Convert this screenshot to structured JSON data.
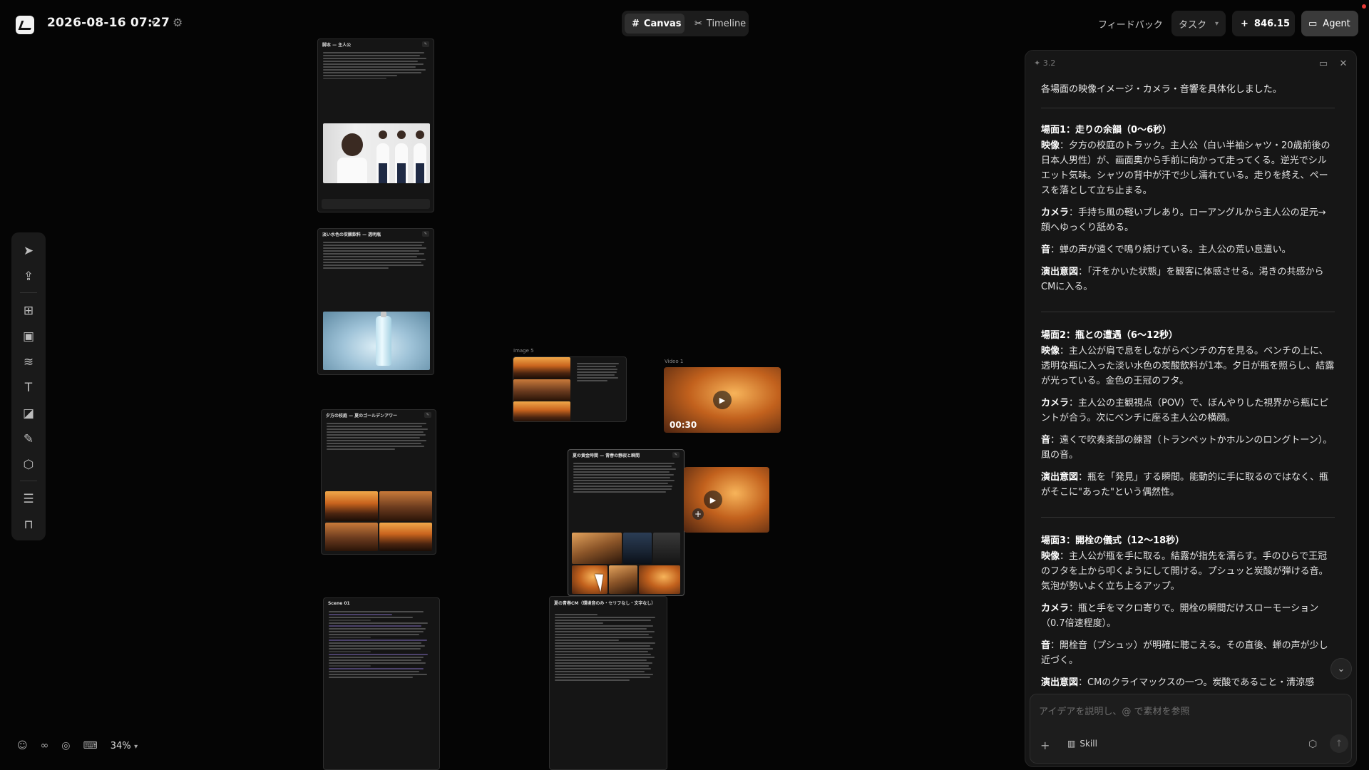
{
  "topbar": {
    "project_title": "2026-08-16 07:27",
    "tabs": [
      {
        "label": "Canvas",
        "icon": "grid-icon"
      },
      {
        "label": "Timeline",
        "icon": "scissors-icon"
      }
    ],
    "feedback_label": "フィードバック",
    "task_label": "タスク",
    "credits": "846.15",
    "agent_label": "Agent"
  },
  "bottom": {
    "zoom": "34%"
  },
  "canvas": {
    "image_label": "Image 5",
    "video_label": "Video 1",
    "video_duration": "00:30",
    "nodes": [
      {
        "title": "脚本 — 主人公"
      },
      {
        "title": "淡い水色の炭酸飲料 — 透明瓶"
      },
      {
        "title": "夕方の校庭 — 夏のゴールデンアワー"
      },
      {
        "title": "夏の黄金時間 — 青春の静寂と瞬間"
      },
      {
        "title": "夏の青春CM（環境音のみ・セリフなし・文字なし）"
      },
      {
        "title": "Scene 01"
      }
    ]
  },
  "panel": {
    "version": "3.2",
    "intro": "各場面の映像イメージ・カメラ・音響を具体化しました。",
    "scenes": [
      {
        "title": "場面1：走りの余韻（0〜6秒）",
        "items": [
          {
            "label": "映像",
            "text": "：夕方の校庭のトラック。主人公（白い半袖シャツ・20歳前後の日本人男性）が、画面奥から手前に向かって走ってくる。逆光でシルエット気味。シャツの背中が汗で少し濡れている。走りを終え、ペースを落として立ち止まる。"
          },
          {
            "label": "カメラ",
            "text": "：手持ち風の軽いブレあり。ローアングルから主人公の足元→顔へゆっくり舐める。"
          },
          {
            "label": "音",
            "text": "：蝉の声が遠くで鳴り続けている。主人公の荒い息遣い。"
          },
          {
            "label": "演出意図",
            "text": "：「汗をかいた状態」を観客に体感させる。渇きの共感からCMに入る。"
          }
        ]
      },
      {
        "title": "場面2：瓶との遭遇（6〜12秒）",
        "items": [
          {
            "label": "映像",
            "text": "：主人公が肩で息をしながらベンチの方を見る。ベンチの上に、透明な瓶に入った淡い水色の炭酸飲料が1本。夕日が瓶を照らし、結露が光っている。金色の王冠のフタ。"
          },
          {
            "label": "カメラ",
            "text": "：主人公の主観視点（POV）で、ぼんやりした視界から瓶にピントが合う。次にベンチに座る主人公の横顔。"
          },
          {
            "label": "音",
            "text": "：遠くで吹奏楽部の練習（トランペットかホルンのロングトーン）。風の音。"
          },
          {
            "label": "演出意図",
            "text": "：瓶を「発見」する瞬間。能動的に手に取るのではなく、瓶がそこに\"あった\"という偶然性。"
          }
        ]
      },
      {
        "title": "場面3：開栓の儀式（12〜18秒）",
        "items": [
          {
            "label": "映像",
            "text": "：主人公が瓶を手に取る。結露が指先を濡らす。手のひらで王冠のフタを上から叩くようにして開ける。プシュッと炭酸が弾ける音。気泡が勢いよく立ち上るアップ。"
          },
          {
            "label": "カメラ",
            "text": "：瓶と手をマクロ寄りで。開栓の瞬間だけスローモーション（0.7倍速程度）。"
          },
          {
            "label": "音",
            "text": "：開栓音（プシュッ）が明確に聴こえる。その直後、蝉の声が少し近づく。"
          },
          {
            "label": "演出意図",
            "text": "：CMのクライマックスの一つ。炭酸であること・清涼感"
          }
        ]
      }
    ],
    "composer_placeholder": "アイデアを説明し、@ で素材を参照",
    "skill_label": "Skill"
  }
}
